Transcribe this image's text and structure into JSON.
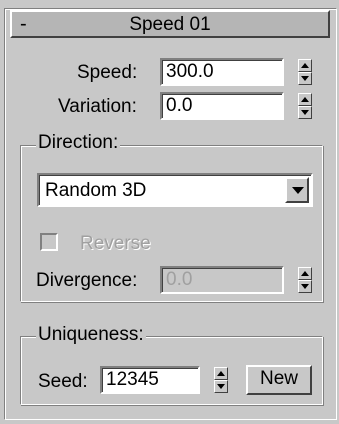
{
  "rollout": {
    "collapse_symbol": "-",
    "title": "Speed 01"
  },
  "speed": {
    "label": "Speed:",
    "value": "300.0"
  },
  "variation": {
    "label": "Variation:",
    "value": "0.0"
  },
  "direction": {
    "group_title": "Direction:",
    "dropdown_value": "Random 3D",
    "reverse_label": "Reverse",
    "reverse_checked": false,
    "divergence_label": "Divergence:",
    "divergence_value": "0.0"
  },
  "uniqueness": {
    "group_title": "Uniqueness:",
    "seed_label": "Seed:",
    "seed_value": "12345",
    "new_button": "New"
  }
}
